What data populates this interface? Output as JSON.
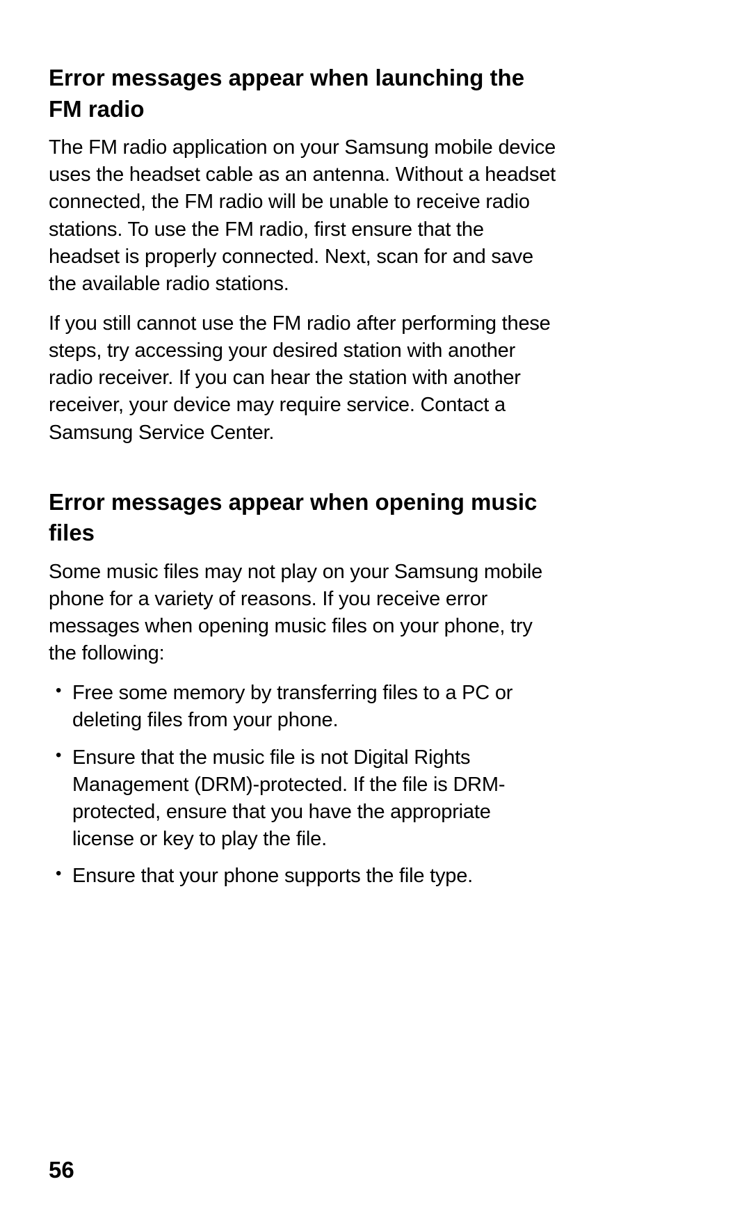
{
  "sections": [
    {
      "heading": "Error messages appear when launching the FM radio",
      "paragraphs": [
        "The FM radio application on your Samsung mobile device uses the headset cable as an antenna. Without a headset connected, the FM radio will be unable to receive radio stations. To use the FM radio, first ensure that the headset is properly connected. Next, scan for and save the available radio stations.",
        "If you still cannot use the FM radio after performing these steps, try accessing your desired station with another radio receiver. If you can hear the station with another receiver, your device may require service. Contact a Samsung Service Center."
      ]
    },
    {
      "heading": "Error messages appear when opening music files",
      "paragraphs": [
        "Some music files may not play on your Samsung mobile phone for a variety of reasons. If you receive error messages when opening music files on your phone, try the following:"
      ],
      "list": [
        "Free some memory by transferring files to a PC or deleting files from your phone.",
        "Ensure that the music file is not Digital Rights Management (DRM)-protected. If the file is DRM-protected, ensure that you have the appropriate license or key to play the file.",
        "Ensure that your phone supports the file type."
      ]
    }
  ],
  "page_number": "56"
}
